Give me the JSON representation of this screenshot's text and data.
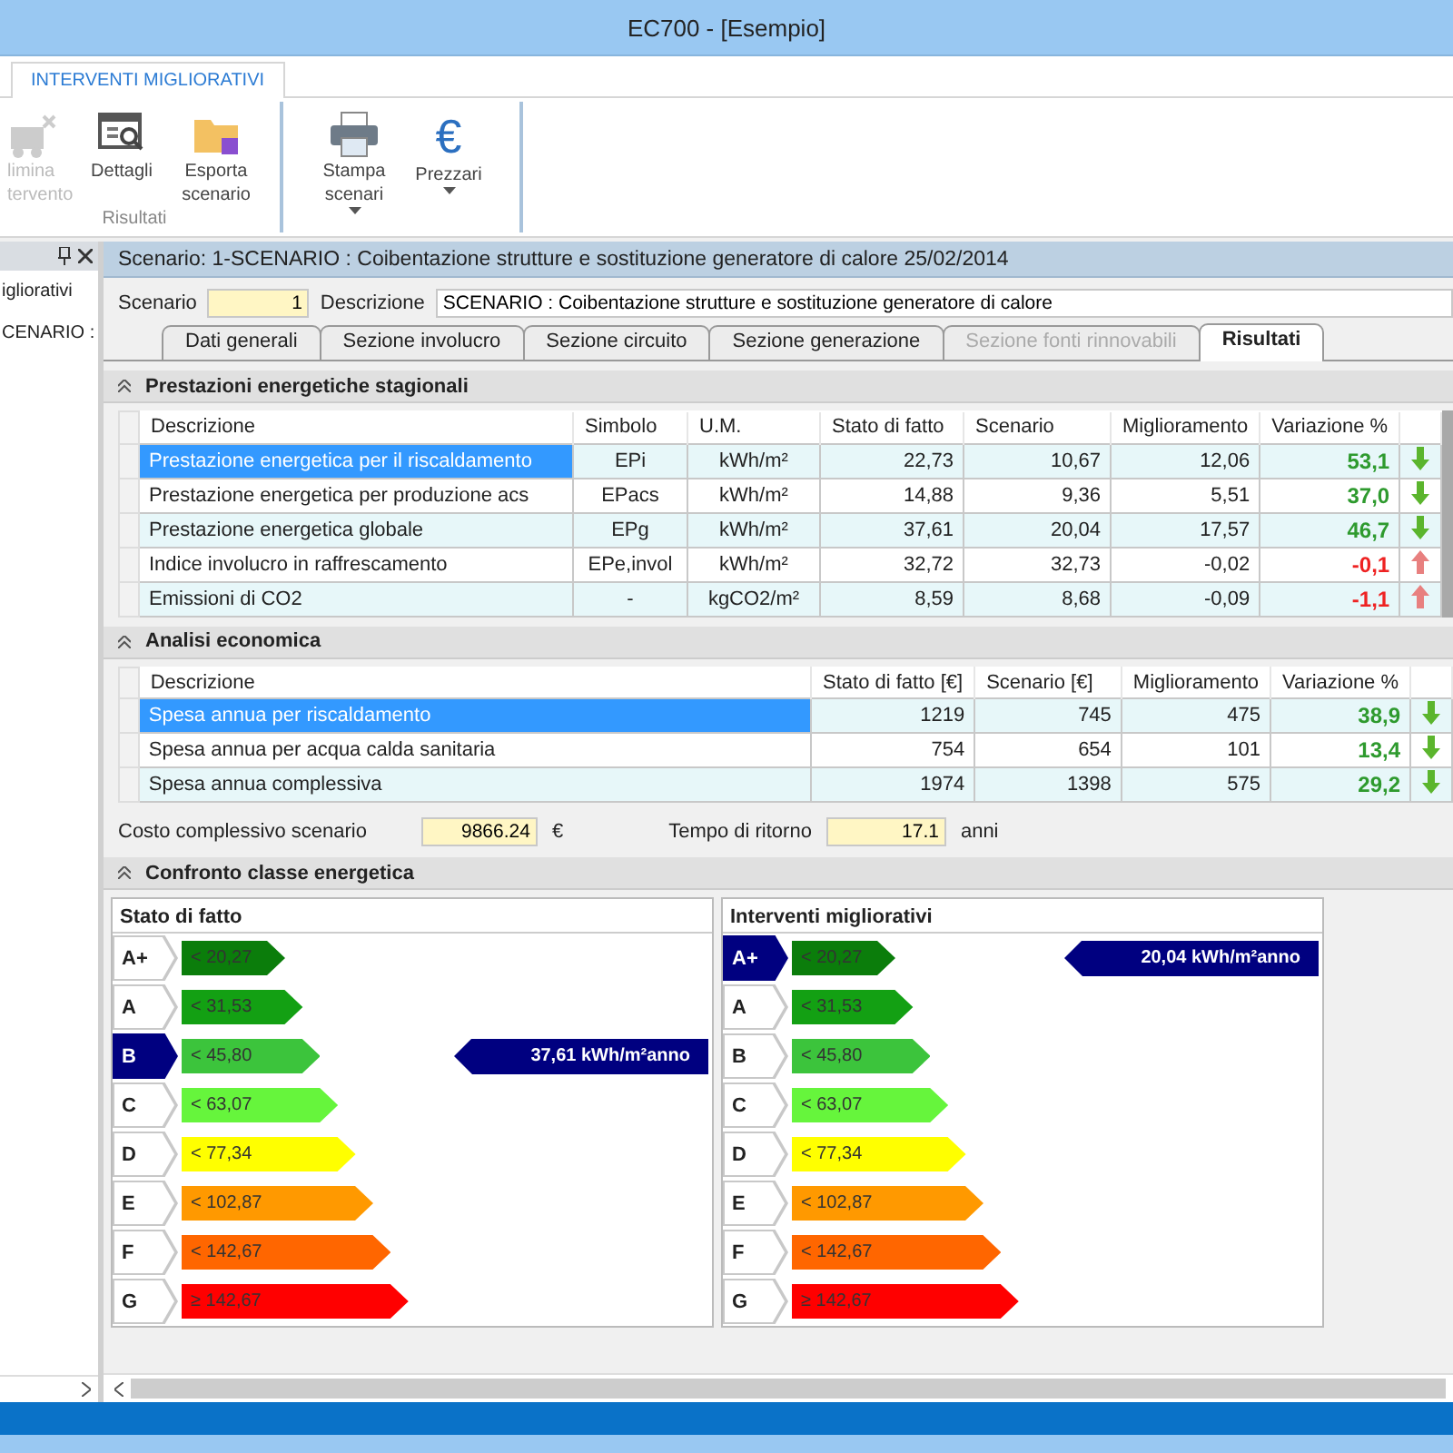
{
  "window": {
    "title": "EC700 - [Esempio]"
  },
  "ribbon": {
    "tabs": [
      {
        "label": "INTERVENTI MIGLIORATIVI",
        "selected": true
      }
    ],
    "groups": [
      {
        "label": "Risultati",
        "buttons": [
          {
            "kind": "remove",
            "lines": [
              "limina",
              "tervento"
            ],
            "disabled": true,
            "dropdown": false
          },
          {
            "kind": "details",
            "lines": [
              "Dettagli"
            ],
            "disabled": false,
            "dropdown": false
          },
          {
            "kind": "export",
            "lines": [
              "Esporta",
              "scenario"
            ],
            "disabled": false,
            "dropdown": false
          }
        ]
      },
      {
        "buttons": [
          {
            "kind": "print",
            "lines": [
              "Stampa",
              "scenari"
            ],
            "disabled": false,
            "dropdown": true
          },
          {
            "kind": "price",
            "glyph": "€",
            "lines": [
              "Prezzari"
            ],
            "disabled": false,
            "dropdown": true
          }
        ]
      }
    ]
  },
  "side_panel": {
    "items": [
      "igliorativi",
      "CENARIO :"
    ]
  },
  "scenario": {
    "header": "Scenario: 1-SCENARIO : Coibentazione strutture e sostituzione generatore di calore 25/02/2014",
    "number_label": "Scenario",
    "number": "1",
    "description_label": "Descrizione",
    "description": "SCENARIO : Coibentazione strutture e sostituzione generatore di calore"
  },
  "tabs": [
    {
      "label": "Dati generali",
      "selected": false,
      "disabled": false
    },
    {
      "label": "Sezione involucro",
      "selected": false,
      "disabled": false
    },
    {
      "label": "Sezione circuito",
      "selected": false,
      "disabled": false
    },
    {
      "label": "Sezione generazione",
      "selected": false,
      "disabled": false
    },
    {
      "label": "Sezione fonti rinnovabili",
      "selected": false,
      "disabled": true
    },
    {
      "label": "Risultati",
      "selected": true,
      "disabled": false
    }
  ],
  "performance": {
    "title": "Prestazioni energetiche stagionali",
    "columns": [
      "Descrizione",
      "Simbolo",
      "U.M.",
      "Stato di fatto",
      "Scenario",
      "Miglioramento",
      "Variazione %"
    ],
    "rows": [
      {
        "cells": [
          "Prestazione energetica per il riscaldamento",
          "EPi",
          "kWh/m²",
          "22,73",
          "10,67",
          "12,06"
        ],
        "variation": "53,1",
        "kind": "down",
        "selected": true
      },
      {
        "cells": [
          "Prestazione energetica per produzione acs",
          "EPacs",
          "kWh/m²",
          "14,88",
          "9,36",
          "5,51"
        ],
        "variation": "37,0",
        "kind": "down",
        "selected": false
      },
      {
        "cells": [
          "Prestazione energetica globale",
          "EPg",
          "kWh/m²",
          "37,61",
          "20,04",
          "17,57"
        ],
        "variation": "46,7",
        "kind": "down",
        "selected": false
      },
      {
        "cells": [
          "Indice involucro in raffrescamento",
          "EPe,invol",
          "kWh/m²",
          "32,72",
          "32,73",
          "-0,02"
        ],
        "variation": "-0,1",
        "kind": "up",
        "selected": false
      },
      {
        "cells": [
          "Emissioni di CO2",
          "-",
          "kgCO2/m²",
          "8,59",
          "8,68",
          "-0,09"
        ],
        "variation": "-1,1",
        "kind": "up",
        "selected": false
      }
    ]
  },
  "economy": {
    "title": "Analisi economica",
    "columns": [
      "Descrizione",
      "Stato di fatto [€]",
      "Scenario [€]",
      "Miglioramento",
      "Variazione %"
    ],
    "rows": [
      {
        "cells": [
          "Spesa annua per riscaldamento",
          "1219",
          "745",
          "475"
        ],
        "variation": "38,9",
        "kind": "down",
        "selected": true
      },
      {
        "cells": [
          "Spesa annua per acqua calda sanitaria",
          "754",
          "654",
          "101"
        ],
        "variation": "13,4",
        "kind": "down",
        "selected": false
      },
      {
        "cells": [
          "Spesa annua complessiva",
          "1974",
          "1398",
          "575"
        ],
        "variation": "29,2",
        "kind": "down",
        "selected": false
      }
    ]
  },
  "totals": {
    "cost_label": "Costo complessivo scenario",
    "cost": "9866.24",
    "cost_unit": "€",
    "return_label": "Tempo di ritorno",
    "return": "17.1",
    "return_unit": "anni"
  },
  "comparison": {
    "title": "Confronto classe energetica",
    "panels": [
      {
        "title": "Stato di fatto",
        "reading": "37,61 kWh/m²anno",
        "classes": [
          {
            "label": "A+",
            "threshold": "< 20,27",
            "color": "#0b7d0b",
            "selected": false
          },
          {
            "label": "A",
            "threshold": "< 31,53",
            "color": "#13a013",
            "selected": false
          },
          {
            "label": "B",
            "threshold": "< 45,80",
            "color": "#3cc43c",
            "selected": true
          },
          {
            "label": "C",
            "threshold": "< 63,07",
            "color": "#66f53c",
            "selected": false
          },
          {
            "label": "D",
            "threshold": "< 77,34",
            "color": "#ffff00",
            "selected": false
          },
          {
            "label": "E",
            "threshold": "< 102,87",
            "color": "#ff9900",
            "selected": false
          },
          {
            "label": "F",
            "threshold": "< 142,67",
            "color": "#ff6600",
            "selected": false
          },
          {
            "label": "G",
            "threshold": "≥ 142,67",
            "color": "#ff0000",
            "selected": false
          }
        ]
      },
      {
        "title": "Interventi migliorativi",
        "reading": "20,04 kWh/m²anno",
        "classes": [
          {
            "label": "A+",
            "threshold": "< 20,27",
            "color": "#0b7d0b",
            "selected": true
          },
          {
            "label": "A",
            "threshold": "< 31,53",
            "color": "#13a013",
            "selected": false
          },
          {
            "label": "B",
            "threshold": "< 45,80",
            "color": "#3cc43c",
            "selected": false
          },
          {
            "label": "C",
            "threshold": "< 63,07",
            "color": "#66f53c",
            "selected": false
          },
          {
            "label": "D",
            "threshold": "< 77,34",
            "color": "#ffff00",
            "selected": false
          },
          {
            "label": "E",
            "threshold": "< 102,87",
            "color": "#ff9900",
            "selected": false
          },
          {
            "label": "F",
            "threshold": "< 142,67",
            "color": "#ff6600",
            "selected": false
          },
          {
            "label": "G",
            "threshold": "≥ 142,67",
            "color": "#ff0000",
            "selected": false
          }
        ]
      }
    ]
  }
}
